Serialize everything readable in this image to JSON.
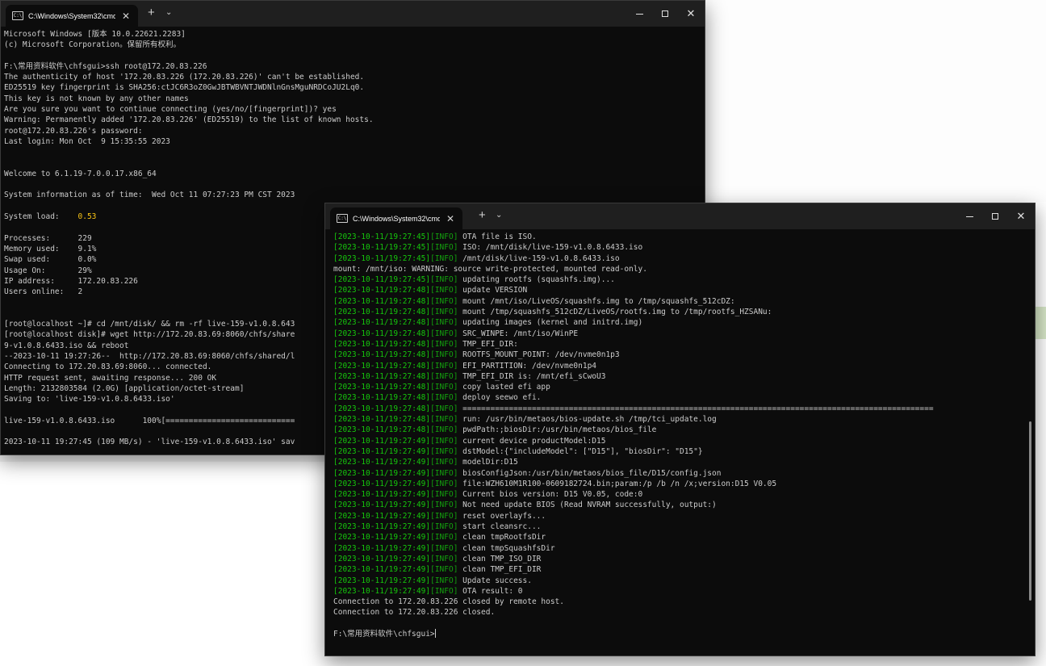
{
  "window1": {
    "tab_title": "C:\\Windows\\System32\\cmd.e",
    "tab_icon_text": "C:\\",
    "lines": [
      "Microsoft Windows [版本 10.0.22621.2283]",
      "(c) Microsoft Corporation。保留所有权利。",
      "",
      "F:\\常用资料软件\\chfsgui>ssh root@172.20.83.226",
      "The authenticity of host '172.20.83.226 (172.20.83.226)' can't be established.",
      "ED25519 key fingerprint is SHA256:ctJC6R3oZ0GwJBTWBVNTJWDNlnGnsMguNRDCoJU2Lq0.",
      "This key is not known by any other names",
      "Are you sure you want to continue connecting (yes/no/[fingerprint])? yes",
      "Warning: Permanently added '172.20.83.226' (ED25519) to the list of known hosts.",
      "root@172.20.83.226's password:",
      "Last login: Mon Oct  9 15:35:55 2023",
      "",
      "",
      "Welcome to 6.1.19-7.0.0.17.x86_64",
      "",
      "System information as of time:  Wed Oct 11 07:27:23 PM CST 2023",
      "",
      "",
      "Processes:      229",
      "Memory used:    9.1%",
      "Swap used:      0.0%",
      "Usage On:       29%",
      "IP address:     172.20.83.226",
      "Users online:   2",
      "",
      "",
      "[root@localhost ~]# cd /mnt/disk/ && rm -rf live-159-v1.0.8.643",
      "[root@localhost disk]# wget http://172.20.83.69:8060/chfs/share",
      "9-v1.0.8.6433.iso && reboot",
      "--2023-10-11 19:27:26--  http://172.20.83.69:8060/chfs/shared/l",
      "Connecting to 172.20.83.69:8060... connected.",
      "HTTP request sent, awaiting response... 200 OK",
      "Length: 2132803584 (2.0G) [application/octet-stream]",
      "Saving to: 'live-159-v1.0.8.6433.iso'",
      "",
      "live-159-v1.0.8.6433.iso      100%[============================",
      "",
      "2023-10-11 19:27:45 (109 MB/s) - 'live-159-v1.0.8.6433.iso' sav"
    ],
    "load_label": "System load:    ",
    "load_value": "0.53"
  },
  "window2": {
    "tab_title": "C:\\Windows\\System32\\cmd.e",
    "tab_icon_text": "C:\\",
    "log_prefix_info": "[INFO]",
    "log": [
      {
        "ts": "[2023-10-11/19:27:45]",
        "msg": " OTA file is ISO."
      },
      {
        "ts": "[2023-10-11/19:27:45]",
        "msg": " ISO: /mnt/disk/live-159-v1.0.8.6433.iso"
      },
      {
        "ts": "[2023-10-11/19:27:45]",
        "msg": " /mnt/disk/live-159-v1.0.8.6433.iso"
      },
      {
        "ts": "",
        "msg": "mount: /mnt/iso: WARNING: source write-protected, mounted read-only."
      },
      {
        "ts": "[2023-10-11/19:27:45]",
        "msg": " updating rootfs (squashfs.img)..."
      },
      {
        "ts": "[2023-10-11/19:27:48]",
        "msg": " update VERSION"
      },
      {
        "ts": "[2023-10-11/19:27:48]",
        "msg": " mount /mnt/iso/LiveOS/squashfs.img to /tmp/squashfs_512cDZ:"
      },
      {
        "ts": "[2023-10-11/19:27:48]",
        "msg": " mount /tmp/squashfs_512cDZ/LiveOS/rootfs.img to /tmp/rootfs_HZSANu:"
      },
      {
        "ts": "[2023-10-11/19:27:48]",
        "msg": " updating images (kernel and initrd.img)"
      },
      {
        "ts": "[2023-10-11/19:27:48]",
        "msg": " SRC_WINPE: /mnt/iso/WinPE"
      },
      {
        "ts": "[2023-10-11/19:27:48]",
        "msg": " TMP_EFI_DIR:"
      },
      {
        "ts": "[2023-10-11/19:27:48]",
        "msg": " ROOTFS_MOUNT_POINT: /dev/nvme0n1p3"
      },
      {
        "ts": "[2023-10-11/19:27:48]",
        "msg": " EFI_PARTITION: /dev/nvme0n1p4"
      },
      {
        "ts": "[2023-10-11/19:27:48]",
        "msg": " TMP_EFI_DIR is: /mnt/efi_sCwoU3"
      },
      {
        "ts": "[2023-10-11/19:27:48]",
        "msg": " copy lasted efi app"
      },
      {
        "ts": "[2023-10-11/19:27:48]",
        "msg": " deploy seewo efi."
      },
      {
        "ts": "[2023-10-11/19:27:48]",
        "msg": " ======================================================================================================"
      },
      {
        "ts": "[2023-10-11/19:27:48]",
        "msg": " run: /usr/bin/metaos/bios-update.sh /tmp/tci_update.log"
      },
      {
        "ts": "[2023-10-11/19:27:48]",
        "msg": " pwdPath:;biosDir:/usr/bin/metaos/bios_file"
      },
      {
        "ts": "[2023-10-11/19:27:49]",
        "msg": " current device productModel:D15"
      },
      {
        "ts": "[2023-10-11/19:27:49]",
        "msg": " dstModel:{\"includeModel\": [\"D15\"], \"biosDir\": \"D15\"}"
      },
      {
        "ts": "[2023-10-11/19:27:49]",
        "msg": " modelDir:D15"
      },
      {
        "ts": "[2023-10-11/19:27:49]",
        "msg": " biosConfigJson:/usr/bin/metaos/bios_file/D15/config.json"
      },
      {
        "ts": "[2023-10-11/19:27:49]",
        "msg": " file:WZH610M1R100-0609182724.bin;param:/p /b /n /x;version:D15 V0.05"
      },
      {
        "ts": "[2023-10-11/19:27:49]",
        "msg": " Current bios version: D15 V0.05, code:0"
      },
      {
        "ts": "[2023-10-11/19:27:49]",
        "msg": " Not need update BIOS (Read NVRAM successfully, output:)"
      },
      {
        "ts": "[2023-10-11/19:27:49]",
        "msg": " reset overlayfs..."
      },
      {
        "ts": "[2023-10-11/19:27:49]",
        "msg": " start cleansrc..."
      },
      {
        "ts": "[2023-10-11/19:27:49]",
        "msg": " clean tmpRootfsDir"
      },
      {
        "ts": "[2023-10-11/19:27:49]",
        "msg": " clean tmpSquashfsDir"
      },
      {
        "ts": "[2023-10-11/19:27:49]",
        "msg": " clean TMP_ISO_DIR"
      },
      {
        "ts": "[2023-10-11/19:27:49]",
        "msg": " clean TMP_EFI_DIR"
      },
      {
        "ts": "[2023-10-11/19:27:49]",
        "msg": " Update success."
      },
      {
        "ts": "[2023-10-11/19:27:49]",
        "msg": " OTA result: 0"
      },
      {
        "ts": "",
        "msg": "Connection to 172.20.83.226 closed by remote host."
      },
      {
        "ts": "",
        "msg": "Connection to 172.20.83.226 closed."
      },
      {
        "ts": "",
        "msg": ""
      },
      {
        "ts": "",
        "msg": "F:\\常用资料软件\\chfsgui>"
      }
    ]
  },
  "icons": {
    "minimize": "minimize-icon",
    "maximize": "maximize-icon",
    "close": "close-icon",
    "new_tab": "plus-icon",
    "tab_menu": "chevron-down-icon",
    "terminal": "terminal-icon"
  },
  "colors": {
    "console_bg": "#0c0c0c",
    "titlebar_bg": "#1f1f1f",
    "text": "#cccccc",
    "timestamp": "#16c60c",
    "load_value": "#f9c516"
  },
  "glyphs": {
    "close": "✕",
    "plus": "+",
    "chevron": "⌄"
  }
}
